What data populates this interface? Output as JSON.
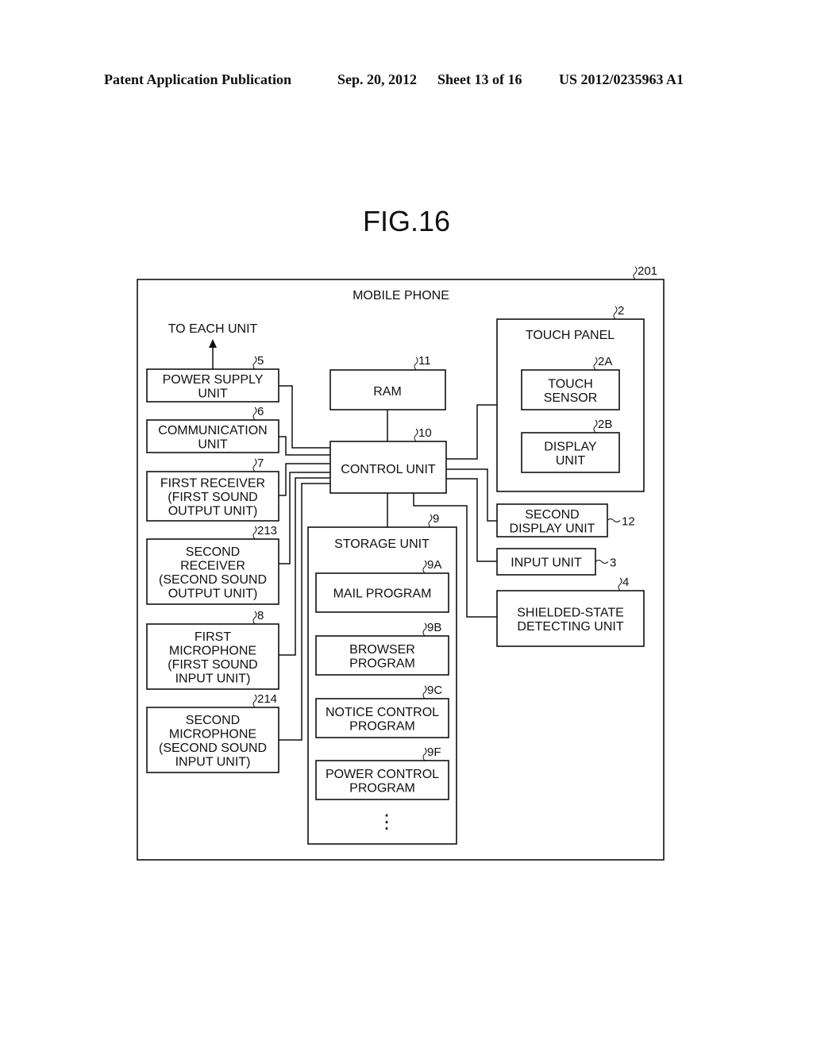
{
  "header": {
    "publication": "Patent Application Publication",
    "date": "Sep. 20, 2012",
    "sheet": "Sheet 13 of 16",
    "patent_number": "US 2012/0235963 A1"
  },
  "figure": {
    "title": "FIG.16",
    "outer": {
      "label": "MOBILE PHONE",
      "ref": "201"
    },
    "to_each_unit": "TO EACH UNIT",
    "left_units": [
      {
        "id": "power",
        "lines": [
          "POWER SUPPLY",
          "UNIT"
        ],
        "ref": "5"
      },
      {
        "id": "comm",
        "lines": [
          "COMMUNICATION",
          "UNIT"
        ],
        "ref": "6"
      },
      {
        "id": "recv1",
        "lines": [
          "FIRST RECEIVER",
          "(FIRST SOUND",
          "OUTPUT UNIT)"
        ],
        "ref": "7"
      },
      {
        "id": "recv2",
        "lines": [
          "SECOND",
          "RECEIVER",
          "(SECOND SOUND",
          "OUTPUT UNIT)"
        ],
        "ref": "213"
      },
      {
        "id": "mic1",
        "lines": [
          "FIRST",
          "MICROPHONE",
          "(FIRST SOUND",
          "INPUT UNIT)"
        ],
        "ref": "8"
      },
      {
        "id": "mic2",
        "lines": [
          "SECOND",
          "MICROPHONE",
          "(SECOND SOUND",
          "INPUT UNIT)"
        ],
        "ref": "214"
      }
    ],
    "ram": {
      "label": "RAM",
      "ref": "11"
    },
    "control": {
      "label": "CONTROL UNIT",
      "ref": "10"
    },
    "storage": {
      "label": "STORAGE UNIT",
      "ref": "9",
      "programs": [
        {
          "lines": [
            "MAIL PROGRAM"
          ],
          "ref": "9A"
        },
        {
          "lines": [
            "BROWSER",
            "PROGRAM"
          ],
          "ref": "9B"
        },
        {
          "lines": [
            "NOTICE CONTROL",
            "PROGRAM"
          ],
          "ref": "9C"
        },
        {
          "lines": [
            "POWER CONTROL",
            "PROGRAM"
          ],
          "ref": "9F"
        }
      ],
      "ellipsis": "⋮"
    },
    "touch_panel": {
      "label": "TOUCH PANEL",
      "ref": "2",
      "touch_sensor": {
        "lines": [
          "TOUCH",
          "SENSOR"
        ],
        "ref": "2A"
      },
      "display": {
        "lines": [
          "DISPLAY",
          "UNIT"
        ],
        "ref": "2B"
      }
    },
    "second_display": {
      "lines": [
        "SECOND",
        "DISPLAY UNIT"
      ],
      "ref": "12"
    },
    "input_unit": {
      "lines": [
        "INPUT UNIT"
      ],
      "ref": "3"
    },
    "shielded": {
      "lines": [
        "SHIELDED-STATE",
        "DETECTING UNIT"
      ],
      "ref": "4"
    }
  }
}
